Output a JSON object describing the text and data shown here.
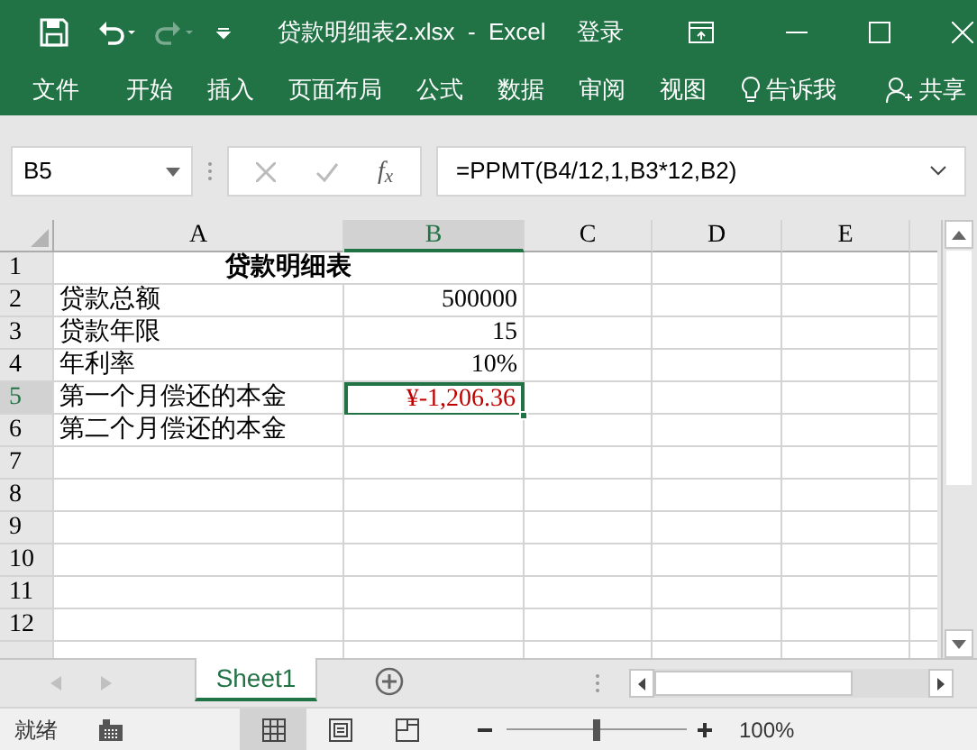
{
  "title_bar": {
    "title": "贷款明细表2.xlsx  -  Excel",
    "sign_in": "登录"
  },
  "ribbon_tabs": [
    {
      "label": "文件"
    },
    {
      "label": "开始"
    },
    {
      "label": "插入"
    },
    {
      "label": "页面布局"
    },
    {
      "label": "公式"
    },
    {
      "label": "数据"
    },
    {
      "label": "审阅"
    },
    {
      "label": "视图"
    }
  ],
  "tell_me": "告诉我",
  "share": "共享",
  "formula_bar": {
    "name_box": "B5",
    "function_label": "f$_{x}$",
    "formula": "=PPMT(B4/12,1,B3*12,B2)"
  },
  "columns": [
    {
      "label": "A",
      "selected": false
    },
    {
      "label": "B",
      "selected": true
    },
    {
      "label": "C",
      "selected": false
    },
    {
      "label": "D",
      "selected": false
    },
    {
      "label": "E",
      "selected": false
    }
  ],
  "rows": [
    {
      "label": "1",
      "selected": false,
      "cells": [
        {
          "kind": "title",
          "text": "贷款明细表"
        }
      ]
    },
    {
      "label": "2",
      "selected": false,
      "cells": [
        {
          "kind": "text",
          "text": "贷款总额"
        },
        {
          "kind": "number",
          "text": "500000"
        }
      ]
    },
    {
      "label": "3",
      "selected": false,
      "cells": [
        {
          "kind": "text",
          "text": "贷款年限"
        },
        {
          "kind": "number",
          "text": "15"
        }
      ]
    },
    {
      "label": "4",
      "selected": false,
      "cells": [
        {
          "kind": "text",
          "text": "年利率"
        },
        {
          "kind": "number",
          "text": "10%"
        }
      ]
    },
    {
      "label": "5",
      "selected": true,
      "cells": [
        {
          "kind": "text",
          "text": "第一个月偿还的本金"
        },
        {
          "kind": "number",
          "text": "¥-1,206.36",
          "color": "#c00000",
          "selected": true
        }
      ]
    },
    {
      "label": "6",
      "selected": false,
      "cells": [
        {
          "kind": "text",
          "text": "第二个月偿还的本金"
        }
      ]
    },
    {
      "label": "7",
      "selected": false,
      "cells": []
    },
    {
      "label": "8",
      "selected": false,
      "cells": []
    },
    {
      "label": "9",
      "selected": false,
      "cells": []
    },
    {
      "label": "10",
      "selected": false,
      "cells": []
    },
    {
      "label": "11",
      "selected": false,
      "cells": []
    },
    {
      "label": "12",
      "selected": false,
      "cells": []
    }
  ],
  "sheet_tabs": [
    {
      "label": "Sheet1",
      "selected": true
    }
  ],
  "status_bar": {
    "status": "就绪",
    "views": [
      {
        "kind": "normal",
        "selected": true
      },
      {
        "kind": "page_layout",
        "selected": false
      },
      {
        "kind": "page_break",
        "selected": false
      }
    ],
    "zoom": {
      "level": 0.5,
      "reading": "100%"
    }
  }
}
